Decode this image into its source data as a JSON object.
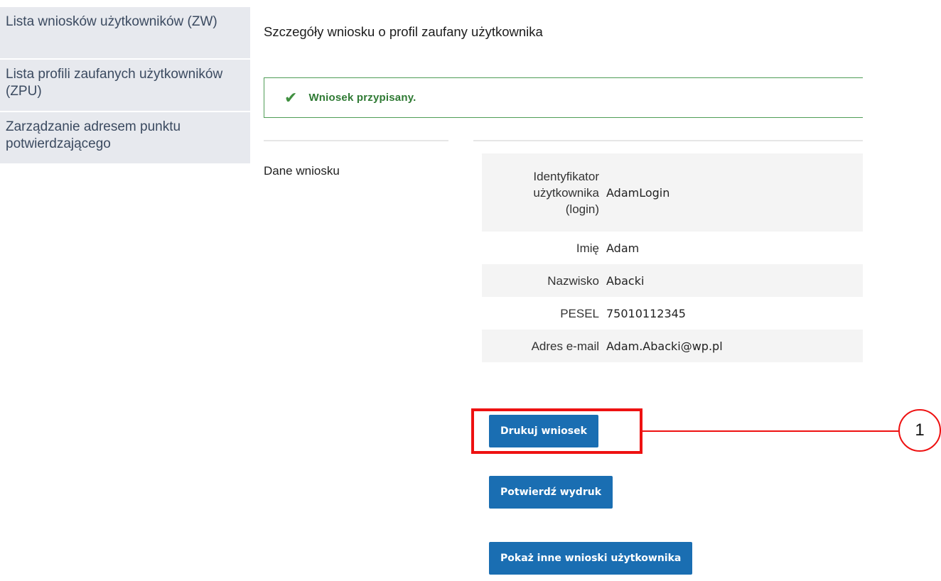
{
  "sidebar": {
    "items": [
      {
        "label": "Lista wniosków użytkowników (ZW)"
      },
      {
        "label": "Lista profili zaufanych użytkowników (ZPU)"
      },
      {
        "label": "Zarządzanie adresem punktu potwierdzającego"
      }
    ]
  },
  "main": {
    "title": "Szczegóły wniosku o profil zaufany użytkownika",
    "alert": {
      "icon": "check-icon",
      "message": "Wniosek przypisany.",
      "color": "#2f7a34"
    },
    "section_label": "Dane wniosku",
    "fields": [
      {
        "label": "Identyfikator użytkownika (login)",
        "value": "AdamLogin"
      },
      {
        "label": "Imię",
        "value": "Adam"
      },
      {
        "label": "Nazwisko",
        "value": "Abacki"
      },
      {
        "label": "PESEL",
        "value": "75010112345"
      },
      {
        "label": "Adres e-mail",
        "value": "Adam.Abacki@wp.pl"
      }
    ],
    "buttons": {
      "print": "Drukuj wniosek",
      "confirm_print": "Potwierdź wydruk",
      "show_other": "Pokaż inne wnioski użytkownika"
    },
    "button_color": "#1a6eb2"
  },
  "annotation": {
    "number": "1",
    "color": "#ee1111"
  }
}
